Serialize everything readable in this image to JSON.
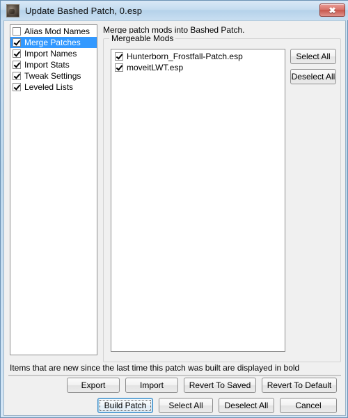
{
  "window": {
    "title": "Update Bashed Patch, 0.esp",
    "icon": "app-icon",
    "close_label": "✖"
  },
  "left_list": {
    "items": [
      {
        "label": "Alias Mod Names",
        "checked": false,
        "selected": false
      },
      {
        "label": "Merge Patches",
        "checked": true,
        "selected": true
      },
      {
        "label": "Import Names",
        "checked": true,
        "selected": false
      },
      {
        "label": "Import Stats",
        "checked": true,
        "selected": false
      },
      {
        "label": "Tweak Settings",
        "checked": true,
        "selected": false
      },
      {
        "label": "Leveled Lists",
        "checked": true,
        "selected": false
      }
    ]
  },
  "right_pane": {
    "description": "Merge patch mods into Bashed Patch.",
    "group_title": "Mergeable Mods",
    "mods": [
      {
        "label": "Hunterborn_Frostfall-Patch.esp",
        "checked": true
      },
      {
        "label": "moveitLWT.esp",
        "checked": true
      }
    ],
    "side_buttons": {
      "select_all": "Select All",
      "deselect_all": "Deselect All"
    }
  },
  "footer": {
    "bold_note": "Items that are new since the last time this patch was built are displayed in bold",
    "row1": {
      "export": "Export",
      "import": "Import",
      "revert_saved": "Revert To Saved",
      "revert_default": "Revert To Default"
    },
    "row2": {
      "build_patch": "Build Patch",
      "select_all": "Select All",
      "deselect_all": "Deselect All",
      "cancel": "Cancel"
    }
  },
  "colors": {
    "selection": "#3399ff",
    "titlebar": "#c5dcf0",
    "close_button": "#c6564c",
    "dialog_bg": "#f0f0f0"
  }
}
